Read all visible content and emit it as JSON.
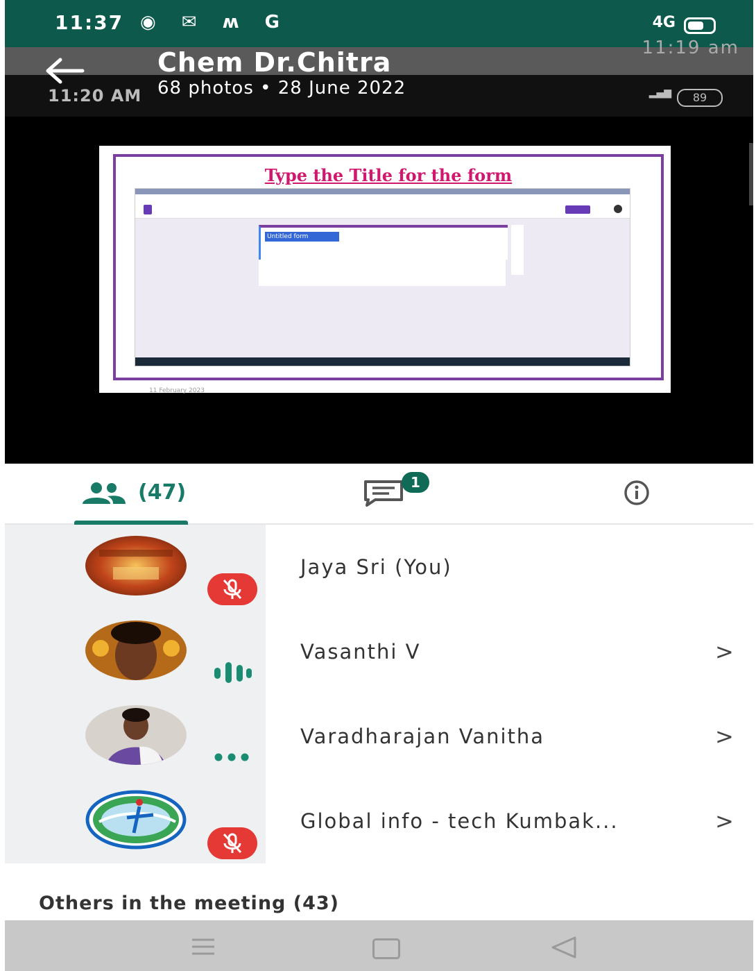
{
  "status_bar": {
    "time": "11:37",
    "left_icons": "◉ ✉ ʍ G",
    "network": "4G"
  },
  "header": {
    "title": "Chem Dr.Chitra",
    "subtitle": "68 photos  •  28 June 2022",
    "overlay_time": "11:20 AM",
    "overlay_time_right": "11:19 am",
    "overlay_battery": "89"
  },
  "presentation": {
    "slide_title": "Type the Title for the form",
    "form_title_field": "Untitled form",
    "slide_footer": "11 February 2023"
  },
  "tabs": {
    "people_count": "(47)",
    "chat_badge": "1"
  },
  "participants": [
    {
      "name": "Jaya Sri (You)",
      "status": "muted",
      "has_chevron": false
    },
    {
      "name": "Vasanthi V",
      "status": "speaking",
      "has_chevron": true
    },
    {
      "name": "Varadharajan Vanitha",
      "status": "connecting",
      "has_chevron": true
    },
    {
      "name": "Global info - tech Kumbak...",
      "status": "muted",
      "has_chevron": true
    }
  ],
  "chevron": ">",
  "others": {
    "label": "Others in the meeting (43)"
  },
  "colors": {
    "status_bar": "#0d5a4c",
    "accent": "#1a7a68",
    "badge": "#0f6b55",
    "muted": "#e53935",
    "slide_title": "#d0186f",
    "slide_frame": "#7b3fa0"
  },
  "icons": [
    "back-arrow-icon",
    "people-icon",
    "chat-icon",
    "info-icon",
    "mic-off-icon",
    "speaking-icon",
    "more-dots-icon",
    "chevron-right-icon",
    "menu-icon",
    "home-icon",
    "back-triangle-icon"
  ]
}
